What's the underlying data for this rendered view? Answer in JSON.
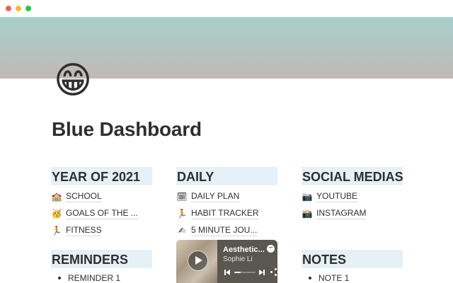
{
  "page": {
    "icon": "😁",
    "icon_name": "grinning-face-icon",
    "title": "Blue Dashboard",
    "cover_colors": [
      "#a6cfcd",
      "#c2b8b4"
    ]
  },
  "sections": {
    "year": {
      "heading": "YEAR OF 2021",
      "links": [
        {
          "emoji": "🏫",
          "icon_name": "school-icon",
          "label": "SCHOOL"
        },
        {
          "emoji": "🥳",
          "icon_name": "party-face-icon",
          "label": "GOALS OF THE ..."
        },
        {
          "emoji": "🏃",
          "icon_name": "running-icon",
          "label": "FITNESS"
        }
      ]
    },
    "daily": {
      "heading": "DAILY",
      "links": [
        {
          "emoji": "🗓",
          "icon_name": "calendar-icon",
          "label": "DAILY PLAN"
        },
        {
          "emoji": "🏃",
          "icon_name": "running-icon",
          "label": "HABIT TRACKER"
        },
        {
          "emoji": "✍",
          "icon_name": "writing-hand-icon",
          "label": "5 MINUTE JOU..."
        }
      ]
    },
    "social": {
      "heading": "SOCIAL MEDIAS",
      "links": [
        {
          "emoji": "📷",
          "icon_name": "camera-icon",
          "label": "YOUTUBE"
        },
        {
          "emoji": "📸",
          "icon_name": "camera-flash-icon",
          "label": "INSTAGRAM"
        }
      ]
    },
    "reminders": {
      "heading": "REMINDERS",
      "items": [
        "REMINDER 1"
      ]
    },
    "notes": {
      "heading": "NOTES",
      "items": [
        "NOTE 1"
      ]
    }
  },
  "player": {
    "track_title": "Aesthetic...",
    "artist": "Sophie Li",
    "progress": 0.3
  },
  "colors": {
    "heading_bg": "#e6f0f7",
    "text": "#2f2f2f"
  }
}
